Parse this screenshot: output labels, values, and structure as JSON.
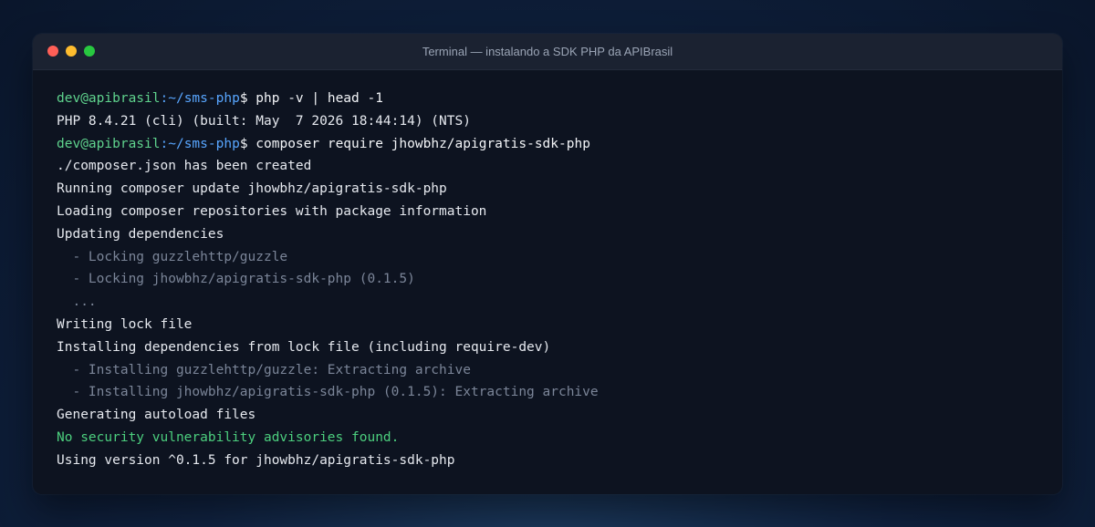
{
  "window": {
    "title": "Terminal — instalando a SDK PHP da APIBrasil",
    "lights": [
      {
        "name": "close",
        "color": "#ff5f57"
      },
      {
        "name": "minimize",
        "color": "#febc2e"
      },
      {
        "name": "maximize",
        "color": "#28c840"
      }
    ]
  },
  "prompt": {
    "user_host": "dev@apibrasil",
    "path": ":~/sms-php",
    "symbol": "$ "
  },
  "lines": [
    {
      "type": "prompt",
      "command": "php -v | head -1"
    },
    {
      "type": "out",
      "text": "PHP 8.4.21 (cli) (built: May  7 2026 18:44:14) (NTS)"
    },
    {
      "type": "prompt",
      "command": "composer require jhowbhz/apigratis-sdk-php"
    },
    {
      "type": "out",
      "text": "./composer.json has been created"
    },
    {
      "type": "out",
      "text": "Running composer update jhowbhz/apigratis-sdk-php"
    },
    {
      "type": "out",
      "text": "Loading composer repositories with package information"
    },
    {
      "type": "out",
      "text": "Updating dependencies"
    },
    {
      "type": "sub",
      "text": "  - Locking guzzlehttp/guzzle"
    },
    {
      "type": "sub",
      "text": "  - Locking jhowbhz/apigratis-sdk-php (0.1.5)"
    },
    {
      "type": "sub",
      "text": "  ..."
    },
    {
      "type": "out",
      "text": "Writing lock file"
    },
    {
      "type": "out",
      "text": "Installing dependencies from lock file (including require-dev)"
    },
    {
      "type": "sub",
      "text": "  - Installing guzzlehttp/guzzle: Extracting archive"
    },
    {
      "type": "sub",
      "text": "  - Installing jhowbhz/apigratis-sdk-php (0.1.5): Extracting archive"
    },
    {
      "type": "out",
      "text": "Generating autoload files"
    },
    {
      "type": "ok",
      "text": "No security vulnerability advisories found."
    },
    {
      "type": "out",
      "text": "Using version ^0.1.5 for jhowbhz/apigratis-sdk-php"
    }
  ]
}
